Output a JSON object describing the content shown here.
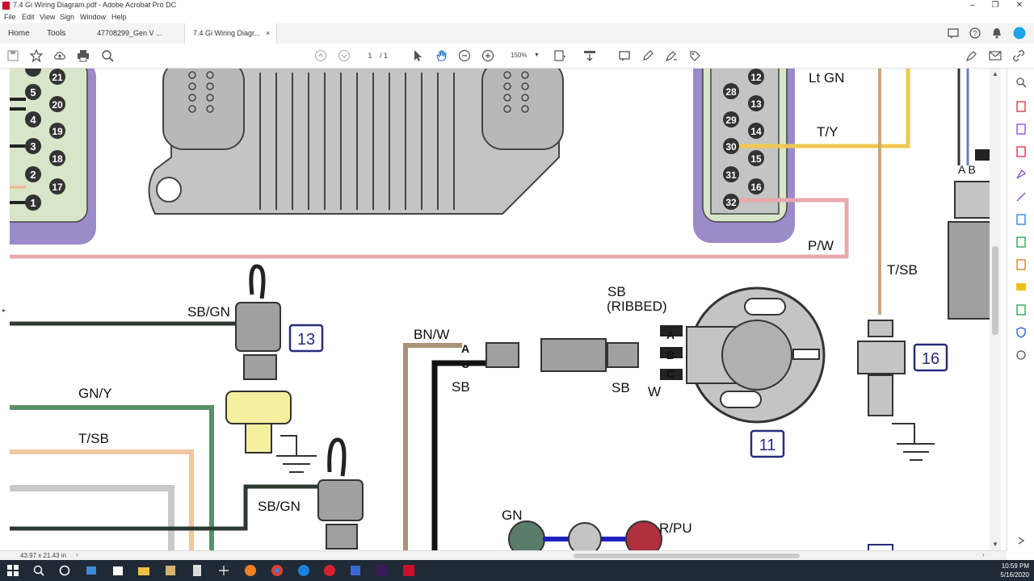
{
  "window": {
    "title": "7.4 Gi Wiring Diagram.pdf - Adobe Acrobat Pro DC"
  },
  "menu": [
    "File",
    "Edit",
    "View",
    "Sign",
    "Window",
    "Help"
  ],
  "tabs": {
    "home": "Home",
    "tools": "Tools",
    "doc1": "47708299_Gen V ...",
    "doc2": "7.4 Gi Wiring Diagr...",
    "close": "×"
  },
  "toolbar": {
    "page_current": "1",
    "page_total": "/ 1",
    "zoom": "150%"
  },
  "diagram": {
    "left_pins": [
      {
        "pin": "21",
        "wire": ""
      },
      {
        "pin": "20",
        "wire": "5"
      },
      {
        "pin": "19",
        "wire": "4"
      },
      {
        "pin": "18",
        "wire": "3"
      },
      {
        "pin": "17",
        "wire": "2"
      },
      {
        "pin": "",
        "wire": "1"
      }
    ],
    "right_pins": [
      {
        "left": "",
        "right": "12"
      },
      {
        "left": "28",
        "right": "13"
      },
      {
        "left": "29",
        "right": "14"
      },
      {
        "left": "30",
        "right": "15"
      },
      {
        "left": "31",
        "right": "16"
      },
      {
        "left": "32",
        "right": ""
      }
    ],
    "labels": {
      "lt_gn": "Lt GN",
      "t_y": "T/Y",
      "p_w": "P/W",
      "t_sb_right": "T/SB",
      "a_b": "A B",
      "sb_gn_1": "SB/GN",
      "sb_gn_2": "SB/GN",
      "gn_y": "GN/Y",
      "t_sb_left": "T/SB",
      "bn_w": "BN/W",
      "sb_1": "SB",
      "sb_2": "SB",
      "sb_ribbed_1": "SB",
      "sb_ribbed_2": "(RIBBED)",
      "w": "W",
      "gn": "GN",
      "r_pu": "R/PU",
      "pin_a": "A",
      "pin_c": "C",
      "dist_a": "A",
      "dist_b": "B",
      "dist_c": "C"
    },
    "callouts": {
      "c13": "13",
      "c11": "11",
      "c16": "16"
    }
  },
  "status": {
    "dimensions": "43.97 x 21.43 in"
  },
  "taskbar": {
    "time": "10:59 PM",
    "date": "5/16/2020"
  },
  "colors": {
    "acrobat_red": "#c8102e",
    "wire_pink": "#e8a9ad",
    "wire_yellow": "#f0c850",
    "wire_tan": "#c8a878",
    "wire_green": "#5a8f6a",
    "connector_purple": "#9b8bc8",
    "connector_green": "#d7e5c8",
    "callout_blue": "#2a2a80"
  }
}
